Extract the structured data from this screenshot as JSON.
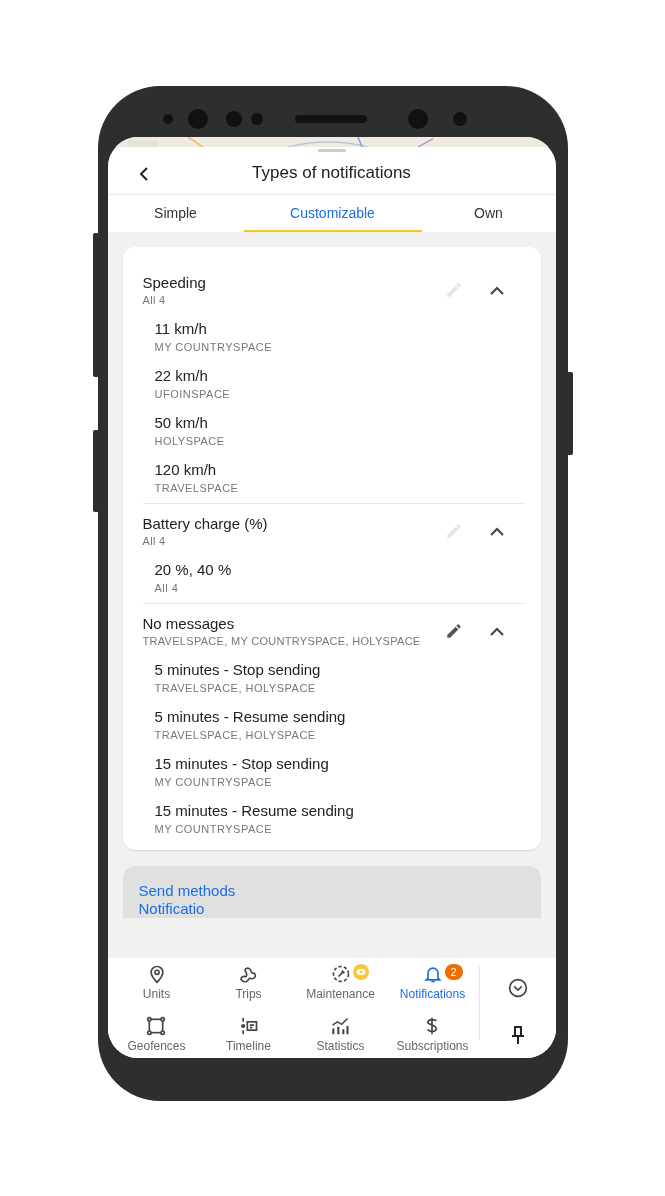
{
  "header": {
    "title": "Types of notifications"
  },
  "tabs": [
    {
      "label": "Simple",
      "selected": false
    },
    {
      "label": "Customizable",
      "selected": true
    },
    {
      "label": "Own",
      "selected": false
    }
  ],
  "groups": [
    {
      "name": "Speeding",
      "subtitle": "All 4",
      "edit_disabled": true,
      "expanded": true,
      "items": [
        {
          "name": "11 km/h",
          "units": "MY COUNTRYSPACE"
        },
        {
          "name": "22 km/h",
          "units": "UFOINSPACE"
        },
        {
          "name": "50 km/h",
          "units": "HOLYSPACE"
        },
        {
          "name": "120 km/h",
          "units": "TRAVELSPACE"
        }
      ]
    },
    {
      "name": "Battery charge (%)",
      "subtitle": "All 4",
      "edit_disabled": true,
      "expanded": true,
      "items": [
        {
          "name": "20 %, 40 %",
          "units": "All 4"
        }
      ]
    },
    {
      "name": "No messages",
      "subtitle": "TRAVELSPACE, MY COUNTRYSPACE, HOLYSPACE",
      "edit_disabled": false,
      "expanded": true,
      "items": [
        {
          "name": "5 minutes - Stop sending",
          "units": "TRAVELSPACE, HOLYSPACE"
        },
        {
          "name": "5 minutes - Resume sending",
          "units": "TRAVELSPACE, HOLYSPACE"
        },
        {
          "name": "15 minutes - Stop sending",
          "units": "MY COUNTRYSPACE"
        },
        {
          "name": "15 minutes - Resume sending",
          "units": "MY COUNTRYSPACE"
        }
      ]
    }
  ],
  "links": [
    "Send methods",
    "Notificatio"
  ],
  "nav": [
    {
      "label": "Units",
      "selected": false
    },
    {
      "label": "Trips",
      "selected": false
    },
    {
      "label": "Maintenance",
      "selected": false,
      "badge": {
        "kind": "eye"
      }
    },
    {
      "label": "Notifications",
      "selected": true,
      "badge": {
        "kind": "count",
        "text": "2"
      }
    },
    {
      "label": "Geofences",
      "selected": false
    },
    {
      "label": "Timeline",
      "selected": false
    },
    {
      "label": "Statistics",
      "selected": false
    },
    {
      "label": "Subscriptions",
      "selected": false
    }
  ]
}
